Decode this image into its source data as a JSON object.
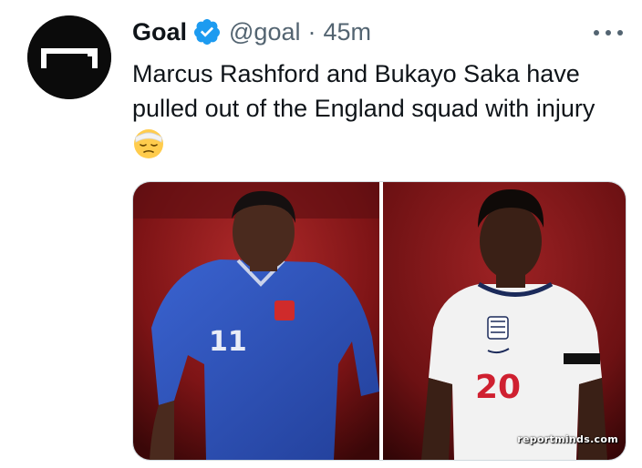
{
  "tweet": {
    "author_name": "Goal",
    "handle": "@goal",
    "separator": "·",
    "time": "45m",
    "text": "Marcus Rashford and Bukayo Saka have pulled out of the England squad with injury",
    "emoji": "face-with-head-bandage-emoji",
    "avatar_icon": "goal-logo-icon",
    "verified_icon": "verified-badge-icon",
    "more_icon": "more-options-icon"
  },
  "media": {
    "left_shirt_number": "11",
    "right_shirt_number": "20",
    "watermark": "reportminds.com"
  },
  "colors": {
    "verified_blue": "#1d9bf0",
    "text_primary": "#0f1419",
    "text_secondary": "#536471",
    "england_blue_kit": "#2c52b8",
    "england_white_kit": "#f2f2f2",
    "stadium_red": "#8f1a1c"
  }
}
